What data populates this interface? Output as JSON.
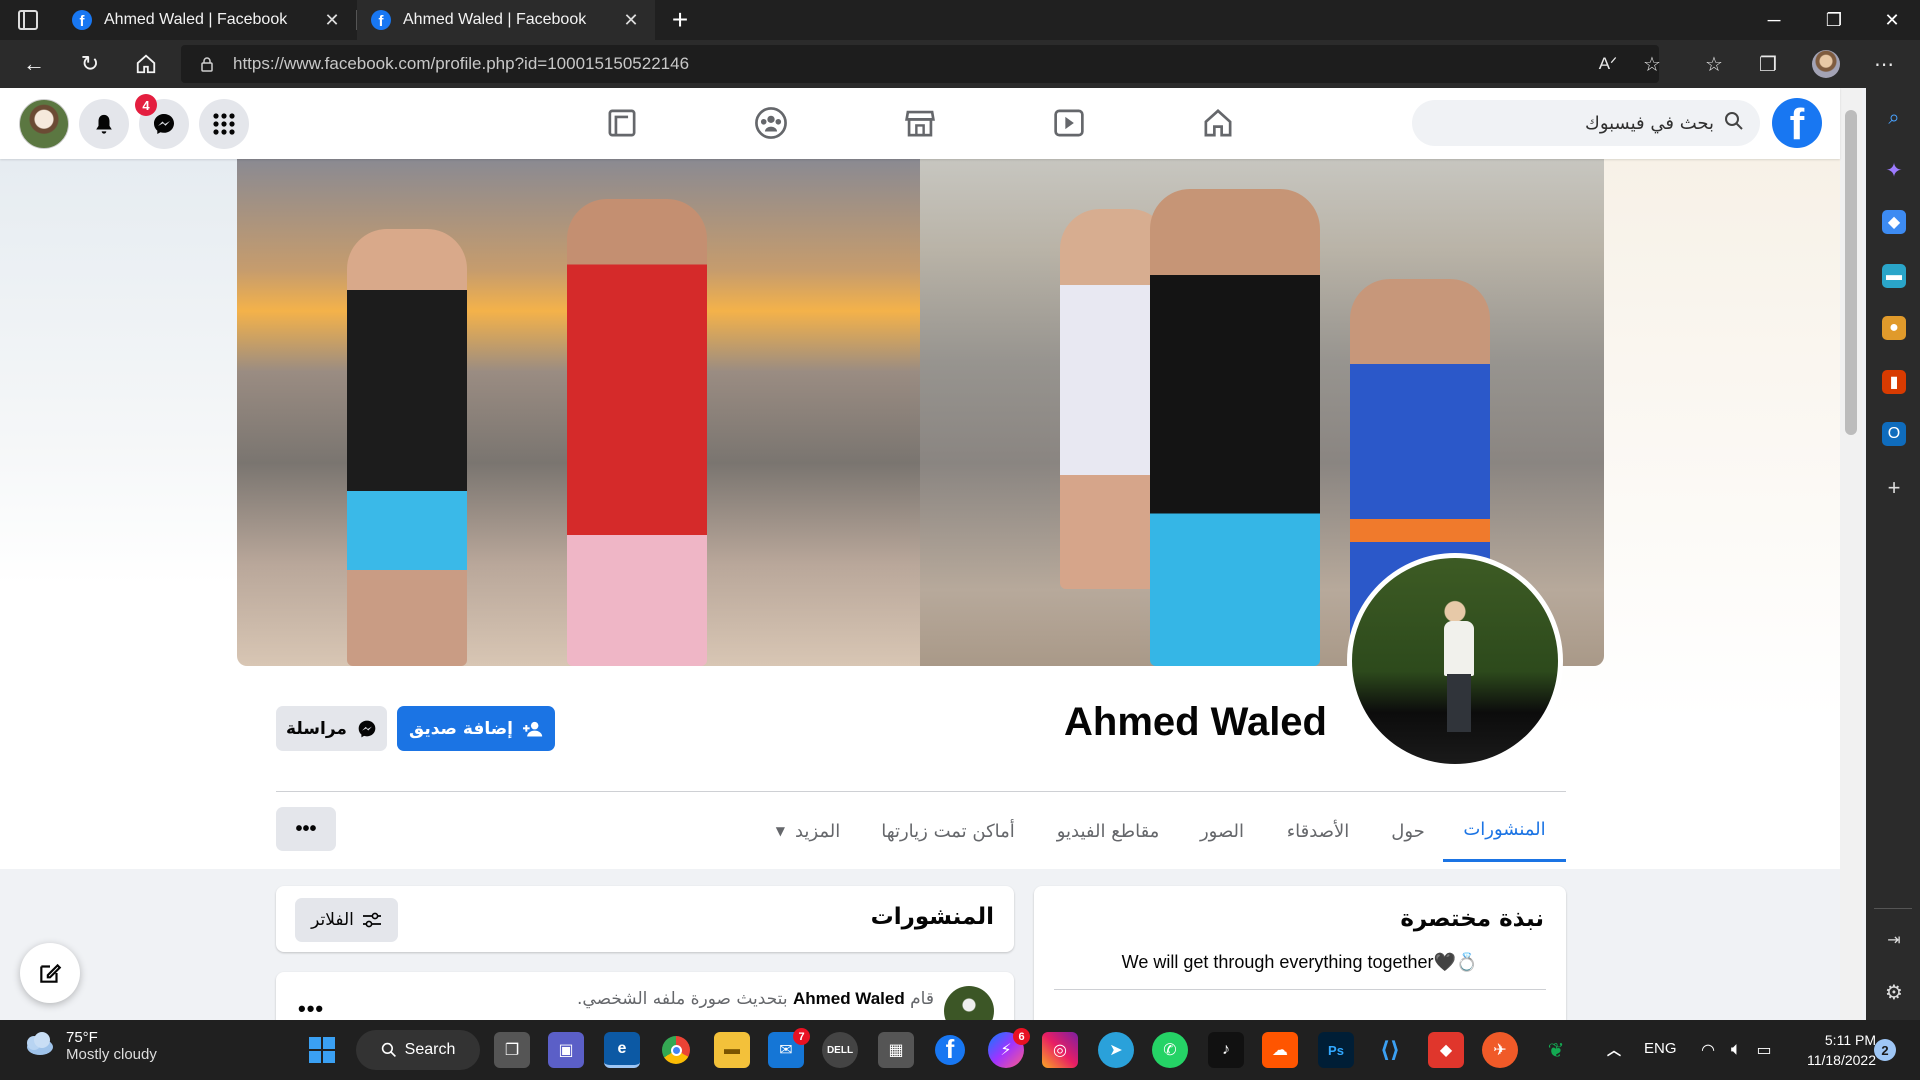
{
  "browser": {
    "tabs": [
      {
        "title": "Ahmed Waled | Facebook"
      },
      {
        "title": "Ahmed Waled | Facebook"
      }
    ],
    "url": "https://www.facebook.com/profile.php?id=100015150522146",
    "new_tab_label": "+"
  },
  "facebook": {
    "logo": "f",
    "search_placeholder": "بحث في فيسبوك",
    "notification_count": "4",
    "nav_icons": [
      "home-icon",
      "watch-icon",
      "marketplace-icon",
      "groups-icon",
      "gaming-icon"
    ]
  },
  "profile": {
    "name": "Ahmed Waled",
    "add_friend_label": "إضافة صديق",
    "message_label": "مراسلة",
    "tabs": [
      {
        "label": "المنشورات"
      },
      {
        "label": "حول"
      },
      {
        "label": "الأصدقاء"
      },
      {
        "label": "الصور"
      },
      {
        "label": "مقاطع الفيديو"
      },
      {
        "label": "أماكن تمت زيارتها"
      },
      {
        "label": "المزيد"
      }
    ],
    "more_options_label": "•••"
  },
  "intro": {
    "title": "نبذة مختصرة",
    "bio": "We will get through everything together🖤💍"
  },
  "posts": {
    "title": "المنشورات",
    "filters_label": "الفلاتر",
    "first_post": {
      "prefix": "قام",
      "author": "Ahmed Waled",
      "action": "بتحديث صورة ملفه الشخصي."
    },
    "menu_label": "•••"
  },
  "taskbar": {
    "weather_temp": "75°F",
    "weather_condition": "Mostly cloudy",
    "search_label": "Search",
    "mail_badge": "7",
    "messenger_badge": "6",
    "language": "ENG",
    "time": "5:11 PM",
    "date": "11/18/2022",
    "notification_count": "2"
  },
  "colors": {
    "fb_blue": "#1877f2",
    "active_tab_blue": "#1b74e4",
    "notification_red": "#e41e3f"
  }
}
